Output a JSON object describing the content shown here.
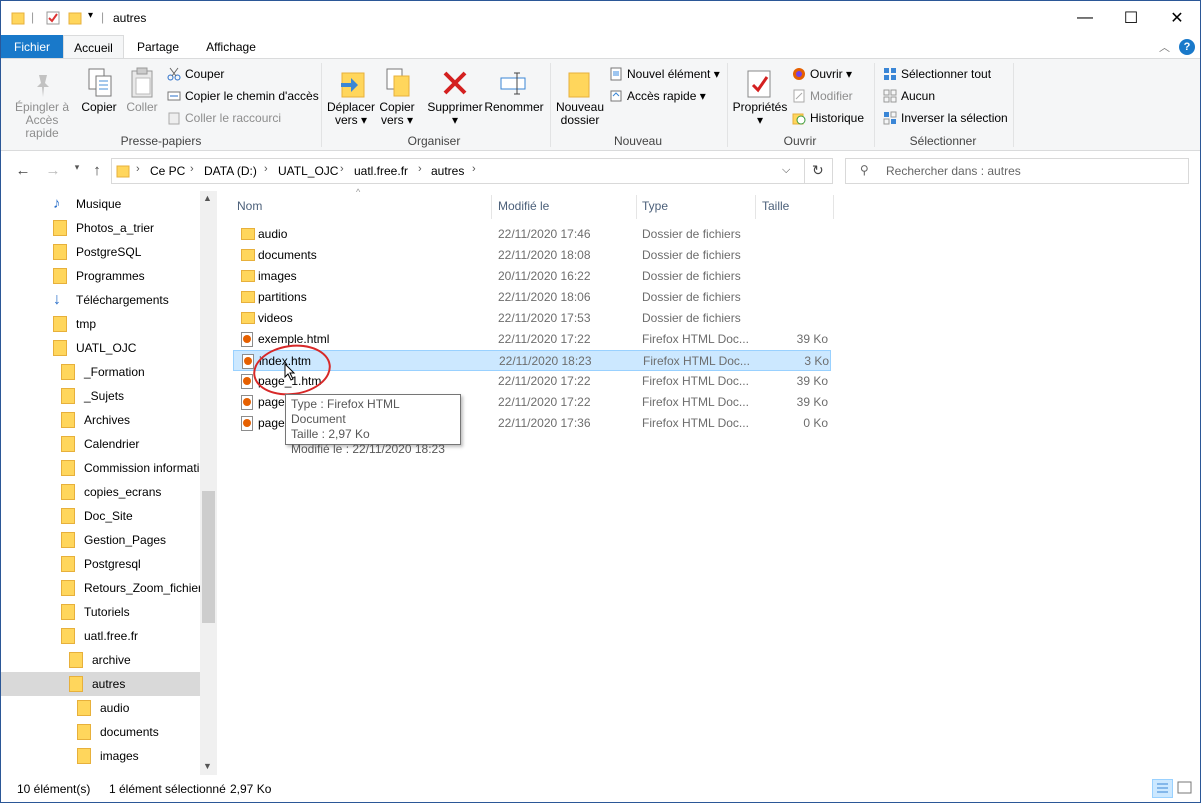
{
  "window": {
    "title": "autres",
    "controls": {
      "minimize": "—",
      "maximize": "☐",
      "close": "✕"
    }
  },
  "ribbon_tabs": [
    {
      "label": "Fichier"
    },
    {
      "label": "Accueil"
    },
    {
      "label": "Partage"
    },
    {
      "label": "Affichage"
    }
  ],
  "ribbon": {
    "groups": {
      "clipboard": "Presse-papiers",
      "organize": "Organiser",
      "new": "Nouveau",
      "open": "Ouvrir",
      "select": "Sélectionner"
    },
    "pin_line1": "Épingler à",
    "pin_line2": "Accès rapide",
    "copy": "Copier",
    "paste": "Coller",
    "cut": "Couper",
    "copy_path": "Copier le chemin d'accès",
    "paste_shortcut": "Coller le raccourci",
    "move_line1": "Déplacer",
    "move_line2": "vers",
    "copyto_line1": "Copier",
    "copyto_line2": "vers",
    "delete": "Supprimer",
    "rename": "Renommer",
    "newfolder_line1": "Nouveau",
    "newfolder_line2": "dossier",
    "new_item": "Nouvel élément",
    "quick_access": "Accès rapide",
    "properties": "Propriétés",
    "open": "Ouvrir",
    "edit": "Modifier",
    "history": "Historique",
    "select_all": "Sélectionner tout",
    "select_none": "Aucun",
    "invert_selection": "Inverser la sélection"
  },
  "address": {
    "crumbs": [
      "Ce PC",
      "DATA (D:)",
      "UATL_OJC",
      "uatl.free.fr",
      "autres"
    ],
    "search_placeholder": "Rechercher dans : autres"
  },
  "nav_tree": [
    {
      "label": "Musique",
      "icon": "music-icon"
    },
    {
      "label": "Photos_a_trier",
      "icon": "folder-icon"
    },
    {
      "label": "PostgreSQL",
      "icon": "folder-icon"
    },
    {
      "label": "Programmes",
      "icon": "folder-icon"
    },
    {
      "label": "Téléchargements",
      "icon": "download-icon"
    },
    {
      "label": "tmp",
      "icon": "folder-icon"
    },
    {
      "label": "UATL_OJC",
      "icon": "folder-icon"
    },
    {
      "label": "_Formation",
      "icon": "folder-icon"
    },
    {
      "label": "_Sujets",
      "icon": "folder-icon"
    },
    {
      "label": "Archives",
      "icon": "folder-icon"
    },
    {
      "label": "Calendrier",
      "icon": "folder-icon"
    },
    {
      "label": "Commission informati",
      "icon": "folder-icon"
    },
    {
      "label": "copies_ecrans",
      "icon": "folder-icon"
    },
    {
      "label": "Doc_Site",
      "icon": "folder-icon"
    },
    {
      "label": "Gestion_Pages",
      "icon": "folder-icon"
    },
    {
      "label": "Postgresql",
      "icon": "folder-icon"
    },
    {
      "label": "Retours_Zoom_fichiers",
      "icon": "folder-icon"
    },
    {
      "label": "Tutoriels",
      "icon": "folder-icon"
    },
    {
      "label": "uatl.free.fr",
      "icon": "folder-icon"
    },
    {
      "label": "archive",
      "icon": "folder-icon"
    },
    {
      "label": "autres",
      "icon": "folder-icon",
      "selected": true
    },
    {
      "label": "audio",
      "icon": "folder-icon"
    },
    {
      "label": "documents",
      "icon": "folder-icon"
    },
    {
      "label": "images",
      "icon": "folder-icon"
    }
  ],
  "columns": {
    "name": "Nom",
    "modified": "Modifié le",
    "type": "Type",
    "size": "Taille"
  },
  "files": [
    {
      "name": "audio",
      "modified": "22/11/2020 17:46",
      "type": "Dossier de fichiers",
      "size": "",
      "kind": "folder"
    },
    {
      "name": "documents",
      "modified": "22/11/2020 18:08",
      "type": "Dossier de fichiers",
      "size": "",
      "kind": "folder"
    },
    {
      "name": "images",
      "modified": "20/11/2020 16:22",
      "type": "Dossier de fichiers",
      "size": "",
      "kind": "folder"
    },
    {
      "name": "partitions",
      "modified": "22/11/2020 18:06",
      "type": "Dossier de fichiers",
      "size": "",
      "kind": "folder"
    },
    {
      "name": "videos",
      "modified": "22/11/2020 17:53",
      "type": "Dossier de fichiers",
      "size": "",
      "kind": "folder"
    },
    {
      "name": "exemple.html",
      "modified": "22/11/2020 17:22",
      "type": "Firefox HTML Doc...",
      "size": "39 Ko",
      "kind": "html"
    },
    {
      "name": "index.htm",
      "modified": "22/11/2020 18:23",
      "type": "Firefox HTML Doc...",
      "size": "3 Ko",
      "kind": "html",
      "selected": true
    },
    {
      "name": "page_1.htm",
      "modified": "22/11/2020 17:22",
      "type": "Firefox HTML Doc...",
      "size": "39 Ko",
      "kind": "html"
    },
    {
      "name": "page",
      "modified": "22/11/2020 17:22",
      "type": "Firefox HTML Doc...",
      "size": "39 Ko",
      "kind": "html"
    },
    {
      "name": "page",
      "modified": "22/11/2020 17:36",
      "type": "Firefox HTML Doc...",
      "size": "0 Ko",
      "kind": "html"
    }
  ],
  "tooltip": {
    "line1": "Type : Firefox HTML Document",
    "line2": "Taille : 2,97 Ko",
    "line3": "Modifié le : 22/11/2020 18:23"
  },
  "status": {
    "count": "10 élément(s)",
    "selection": "1 élément sélectionné",
    "size": "2,97 Ko"
  },
  "colors": {
    "accent": "#1979ca",
    "selection": "#cce8ff",
    "annotation": "#d72828"
  }
}
